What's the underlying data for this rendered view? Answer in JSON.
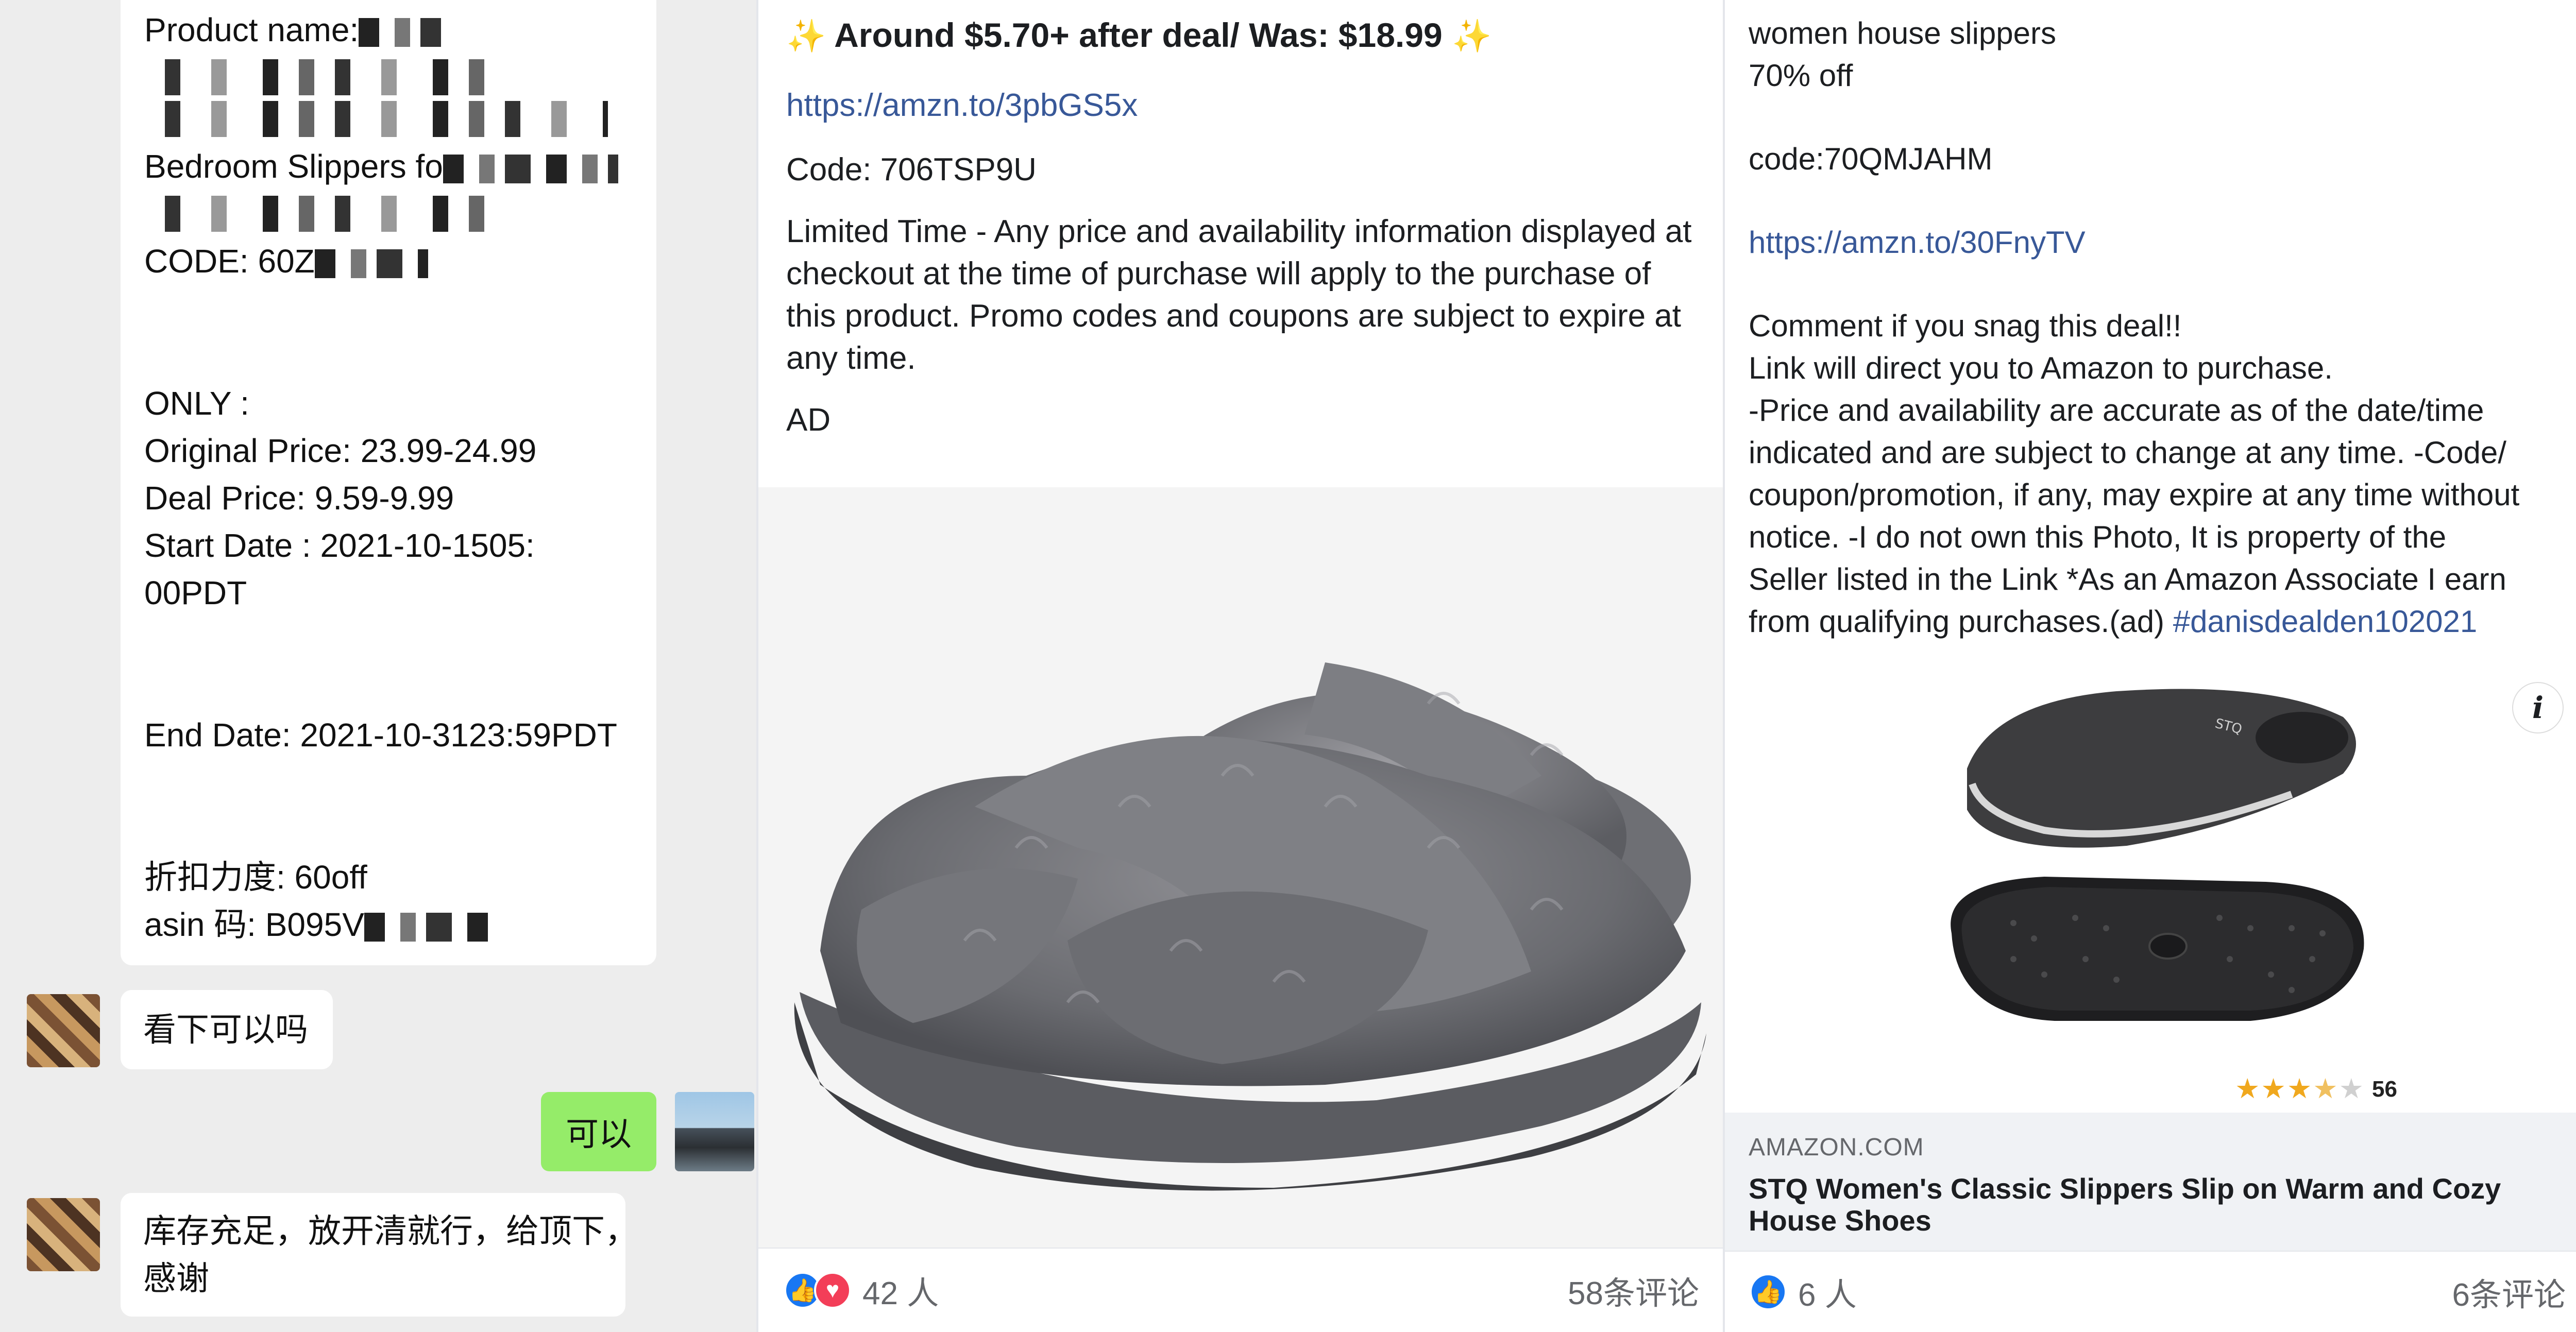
{
  "chat": {
    "product_label": "Product name:",
    "bedroom_line": "Bedroom Slippers fo",
    "code_line": "CODE: 60Z",
    "only_label": "ONLY :",
    "original_price": "Original Price: 23.99-24.99",
    "deal_price": "Deal Price: 9.59-9.99",
    "start_date_1": "Start Date : 2021-10-1505:",
    "start_date_2": "00PDT",
    "end_date": "End Date: 2021-10-3123:59PDT",
    "discount": "折扣力度: 60off",
    "asin": "asin 码: B095V",
    "msg_check": "看下可以吗",
    "msg_ok": "可以",
    "msg_stock_1": "库存充足，放开清就行，给顶下，",
    "msg_stock_2": "感谢"
  },
  "post2": {
    "title": "Around $5.70+ after deal/ Was: $18.99",
    "link": "https://amzn.to/3pbGS5x",
    "code": "Code: 706TSP9U",
    "disclaimer": "Limited Time - Any price and availability information displayed at checkout at the time of purchase will apply to the purchase of this product. Promo codes and coupons are subject to expire at any time.",
    "ad": "AD",
    "reactions_count": "42 人",
    "comments": "58条评论"
  },
  "post3": {
    "line1": "women house slippers",
    "line2": "70% off",
    "code": "code:70QMJAHM",
    "link": "https://amzn.to/30FnyTV",
    "body_lines": [
      "Comment if you snag this deal!!",
      "Link will direct you to Amazon to purchase.",
      "-Price and availability are accurate as of the date/time",
      "indicated and are subject to change at any time. -Code/",
      "coupon/promotion, if any, may expire at any time without",
      "notice. -I do not own this Photo, It is property of the",
      "Seller listed in the Link *As an Amazon Associate I earn",
      "from qualifying purchases.(ad)"
    ],
    "hashtag": "#danisdealden102021",
    "info_icon": "i",
    "rating_stars": 3.5,
    "rating_count": "56",
    "shoe_brand": "STQ",
    "domain": "AMAZON.COM",
    "link_title": "STQ Women's Classic Slippers Slip on Warm and Cozy House Shoes",
    "reactions_count": "6 人",
    "comments": "6条评论"
  },
  "icons": {
    "like": "like-icon",
    "love": "love-icon",
    "info": "info-icon",
    "sparkle": "sparkle-icon"
  },
  "colors": {
    "link_blue": "#385898",
    "like_blue": "#1877f2",
    "love_red": "#f33e58",
    "chat_green": "#95ec69",
    "chat_bg": "#ededed"
  }
}
